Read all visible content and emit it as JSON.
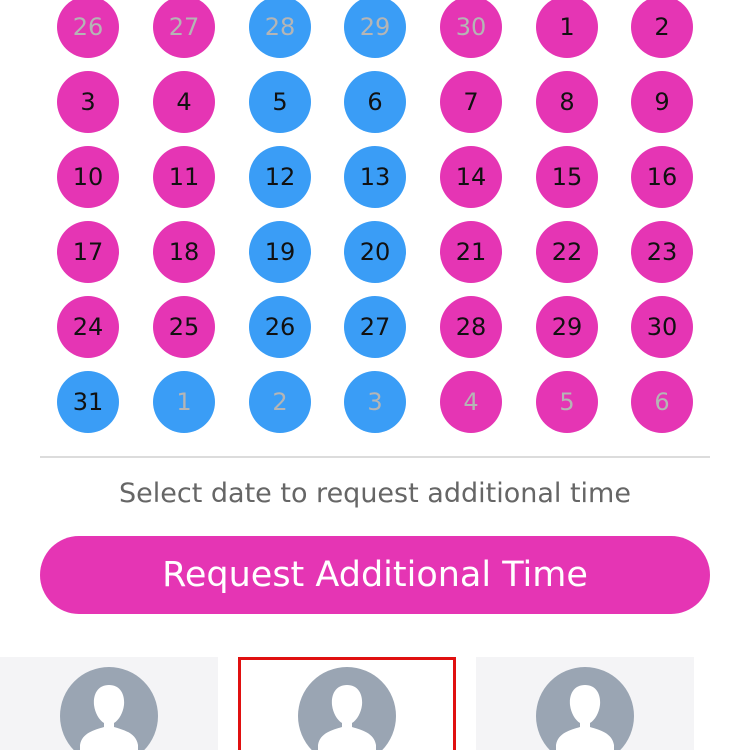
{
  "calendar": {
    "weeks": [
      [
        {
          "label": "26",
          "color": "pink",
          "outside": true
        },
        {
          "label": "27",
          "color": "pink",
          "outside": true
        },
        {
          "label": "28",
          "color": "blue",
          "outside": true
        },
        {
          "label": "29",
          "color": "blue",
          "outside": true
        },
        {
          "label": "30",
          "color": "pink",
          "outside": true
        },
        {
          "label": "1",
          "color": "pink",
          "outside": false
        },
        {
          "label": "2",
          "color": "pink",
          "outside": false
        }
      ],
      [
        {
          "label": "3",
          "color": "pink",
          "outside": false
        },
        {
          "label": "4",
          "color": "pink",
          "outside": false
        },
        {
          "label": "5",
          "color": "blue",
          "outside": false
        },
        {
          "label": "6",
          "color": "blue",
          "outside": false
        },
        {
          "label": "7",
          "color": "pink",
          "outside": false
        },
        {
          "label": "8",
          "color": "pink",
          "outside": false
        },
        {
          "label": "9",
          "color": "pink",
          "outside": false
        }
      ],
      [
        {
          "label": "10",
          "color": "pink",
          "outside": false
        },
        {
          "label": "11",
          "color": "pink",
          "outside": false
        },
        {
          "label": "12",
          "color": "blue",
          "outside": false
        },
        {
          "label": "13",
          "color": "blue",
          "outside": false
        },
        {
          "label": "14",
          "color": "pink",
          "outside": false
        },
        {
          "label": "15",
          "color": "pink",
          "outside": false
        },
        {
          "label": "16",
          "color": "pink",
          "outside": false
        }
      ],
      [
        {
          "label": "17",
          "color": "pink",
          "outside": false
        },
        {
          "label": "18",
          "color": "pink",
          "outside": false
        },
        {
          "label": "19",
          "color": "blue",
          "outside": false
        },
        {
          "label": "20",
          "color": "blue",
          "outside": false
        },
        {
          "label": "21",
          "color": "pink",
          "outside": false
        },
        {
          "label": "22",
          "color": "pink",
          "outside": false
        },
        {
          "label": "23",
          "color": "pink",
          "outside": false
        }
      ],
      [
        {
          "label": "24",
          "color": "pink",
          "outside": false
        },
        {
          "label": "25",
          "color": "pink",
          "outside": false
        },
        {
          "label": "26",
          "color": "blue",
          "outside": false
        },
        {
          "label": "27",
          "color": "blue",
          "outside": false
        },
        {
          "label": "28",
          "color": "pink",
          "outside": false
        },
        {
          "label": "29",
          "color": "pink",
          "outside": false
        },
        {
          "label": "30",
          "color": "pink",
          "outside": false
        }
      ],
      [
        {
          "label": "31",
          "color": "blue",
          "outside": false
        },
        {
          "label": "1",
          "color": "blue",
          "outside": true
        },
        {
          "label": "2",
          "color": "blue",
          "outside": true
        },
        {
          "label": "3",
          "color": "blue",
          "outside": true
        },
        {
          "label": "4",
          "color": "pink",
          "outside": true
        },
        {
          "label": "5",
          "color": "pink",
          "outside": true
        },
        {
          "label": "6",
          "color": "pink",
          "outside": true
        }
      ]
    ]
  },
  "hint_text": "Select date to request additional time",
  "request_button_label": "Request Additional Time",
  "profiles": [
    {
      "avatar_icon": "user-silhouette-icon",
      "selected": false
    },
    {
      "avatar_icon": "user-silhouette-icon",
      "selected": true
    },
    {
      "avatar_icon": "user-silhouette-icon",
      "selected": false
    }
  ],
  "colors": {
    "pink": "#e535b4",
    "blue": "#3a9df6",
    "outside_text": "#b5b5b5",
    "selection_border": "#e01010"
  }
}
